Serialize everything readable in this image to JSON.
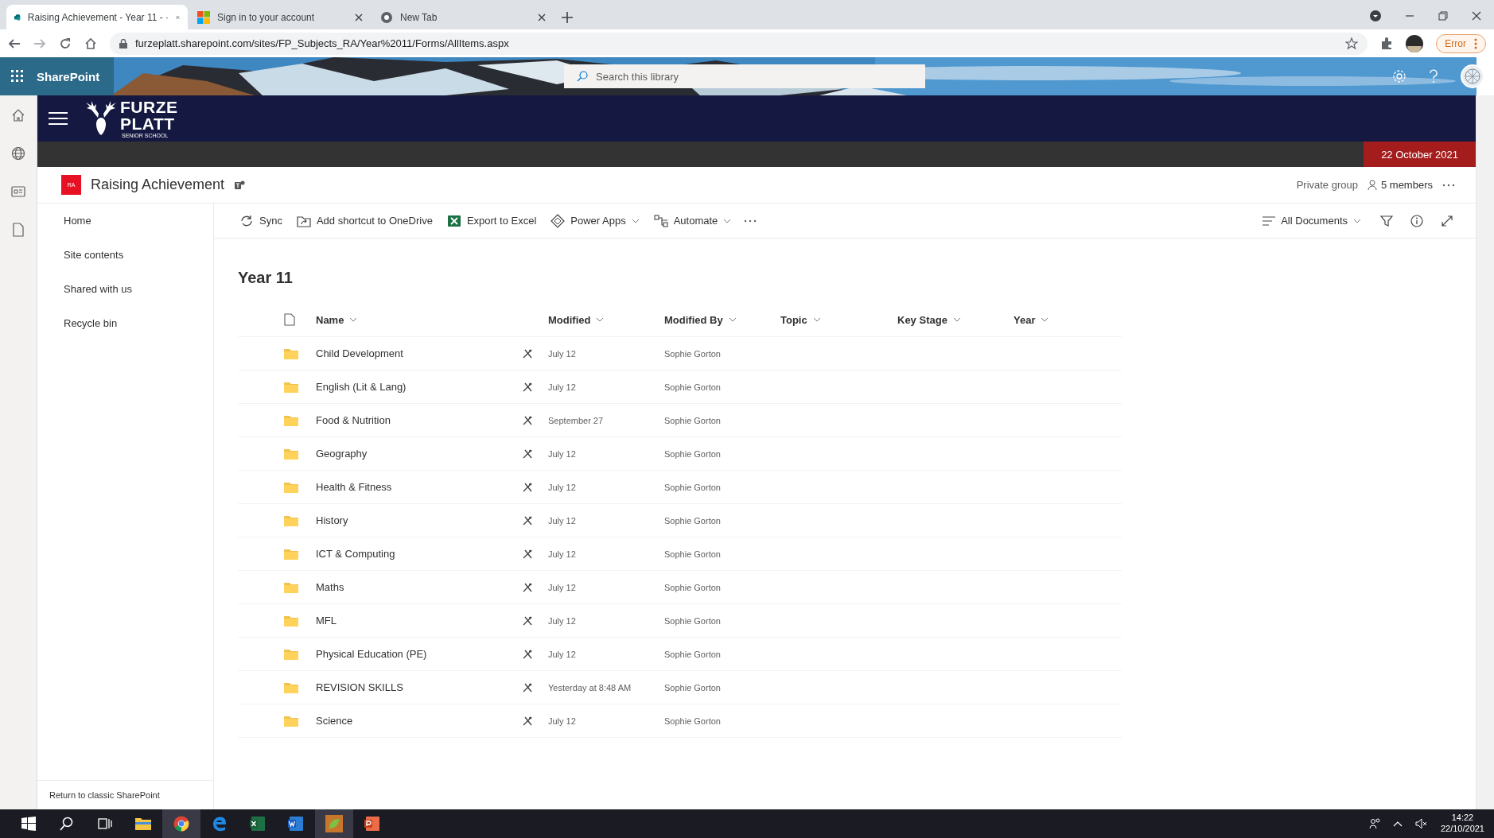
{
  "browser": {
    "tabs": [
      {
        "title": "Raising Achievement - Year 11 - ·",
        "selected": true
      },
      {
        "title": "Sign in to your account",
        "selected": false
      },
      {
        "title": "New Tab",
        "selected": false
      }
    ],
    "url": "furzeplatt.sharepoint.com/sites/FP_Subjects_RA/Year%2011/Forms/AllItems.aspx",
    "profile_status": "Error"
  },
  "suite_bar": {
    "app_name": "SharePoint",
    "search": {
      "placeholder": "Search this library"
    }
  },
  "site_header": {
    "logo_lines": [
      "FURZE",
      "PLATT",
      "SENIOR SCHOOL"
    ],
    "date": "22 October 2021"
  },
  "site": {
    "badge": "RA",
    "title": "Raising Achievement",
    "privacy": "Private group",
    "members": "5 members"
  },
  "nav": {
    "items": [
      {
        "label": "Home"
      },
      {
        "label": "Site contents"
      },
      {
        "label": "Shared with us"
      },
      {
        "label": "Recycle bin"
      }
    ],
    "footer_link": "Return to classic SharePoint"
  },
  "command_bar": {
    "commands": [
      {
        "label": "Sync",
        "dropdown": false
      },
      {
        "label": "Add shortcut to OneDrive",
        "dropdown": false
      },
      {
        "label": "Export to Excel",
        "dropdown": false
      },
      {
        "label": "Power Apps",
        "dropdown": true
      },
      {
        "label": "Automate",
        "dropdown": true
      }
    ],
    "view": "All Documents"
  },
  "library": {
    "title": "Year 11",
    "columns": [
      {
        "label": "Name"
      },
      {
        "label": "Modified"
      },
      {
        "label": "Modified By"
      },
      {
        "label": "Topic"
      },
      {
        "label": "Key Stage"
      },
      {
        "label": "Year"
      }
    ],
    "rows": [
      {
        "name": "Child Development",
        "modified": "July 12",
        "modified_by": "Sophie Gorton"
      },
      {
        "name": "English (Lit & Lang)",
        "modified": "July 12",
        "modified_by": "Sophie Gorton"
      },
      {
        "name": "Food & Nutrition",
        "modified": "September 27",
        "modified_by": "Sophie Gorton"
      },
      {
        "name": "Geography",
        "modified": "July 12",
        "modified_by": "Sophie Gorton"
      },
      {
        "name": "Health & Fitness",
        "modified": "July 12",
        "modified_by": "Sophie Gorton"
      },
      {
        "name": "History",
        "modified": "July 12",
        "modified_by": "Sophie Gorton"
      },
      {
        "name": "ICT & Computing",
        "modified": "July 12",
        "modified_by": "Sophie Gorton"
      },
      {
        "name": "Maths",
        "modified": "July 12",
        "modified_by": "Sophie Gorton"
      },
      {
        "name": "MFL",
        "modified": "July 12",
        "modified_by": "Sophie Gorton"
      },
      {
        "name": "Physical Education (PE)",
        "modified": "July 12",
        "modified_by": "Sophie Gorton"
      },
      {
        "name": "REVISION SKILLS",
        "modified": "Yesterday at 8:48 AM",
        "modified_by": "Sophie Gorton"
      },
      {
        "name": "Science",
        "modified": "July 12",
        "modified_by": "Sophie Gorton"
      }
    ]
  },
  "taskbar": {
    "time": "14:22",
    "date": "22/10/2021"
  }
}
